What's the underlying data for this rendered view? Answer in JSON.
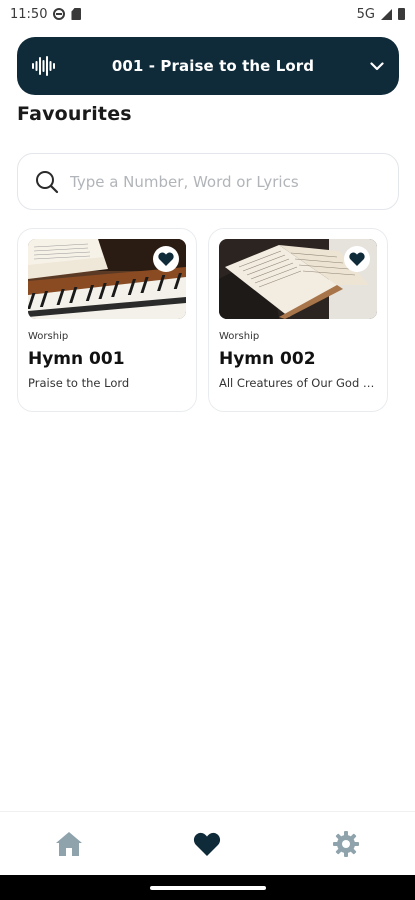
{
  "status_bar": {
    "time": "11:50",
    "network": "5G"
  },
  "now_playing": {
    "title": "001 - Praise to the Lord",
    "icon": "audio-wave-icon",
    "expand_icon": "chevron-down-icon"
  },
  "page": {
    "title": "Favourites"
  },
  "search": {
    "placeholder": "Type a Number, Word or Lyrics",
    "icon": "search-icon"
  },
  "favourites": [
    {
      "category": "Worship",
      "title": "Hymn 001",
      "subtitle": "Praise to the Lord",
      "favourite": true,
      "image": "organ-keyboard-photo"
    },
    {
      "category": "Worship",
      "title": "Hymn 002",
      "subtitle": "All Creatures of Our God and King",
      "favourite": true,
      "image": "hymnal-book-photo"
    }
  ],
  "bottom_nav": {
    "items": [
      {
        "name": "home",
        "icon": "home-icon",
        "active": false
      },
      {
        "name": "favourites",
        "icon": "heart-icon",
        "active": true
      },
      {
        "name": "settings",
        "icon": "gear-icon",
        "active": false
      }
    ]
  },
  "colors": {
    "primary": "#0f2b3a",
    "inactive_nav": "#8fa3ad",
    "card_border": "#e9ecef"
  }
}
